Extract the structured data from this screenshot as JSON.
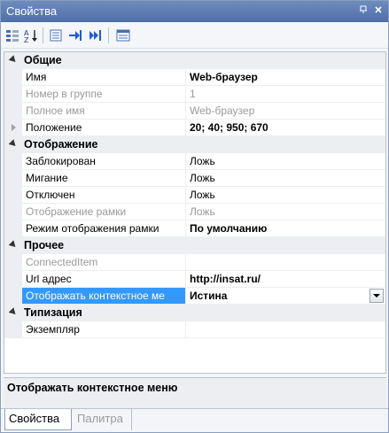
{
  "window": {
    "title": "Свойства"
  },
  "toolbar": {
    "tools": [
      "categorized-icon",
      "alphabetical-icon",
      "properties-icon",
      "events-icon",
      "bindings-icon",
      "property-pages-icon"
    ]
  },
  "grid": {
    "categories": [
      {
        "label": "Общие",
        "props": [
          {
            "name": "Имя",
            "value": "Web-браузер"
          },
          {
            "name": "Номер в группе",
            "value": "1"
          },
          {
            "name": "Полное имя",
            "value": "Web-браузер"
          },
          {
            "name": "Положение",
            "value": "20; 40; 950; 670"
          }
        ]
      },
      {
        "label": "Отображение",
        "props": [
          {
            "name": "Заблокирован",
            "value": "Ложь"
          },
          {
            "name": "Мигание",
            "value": "Ложь"
          },
          {
            "name": "Отключен",
            "value": "Ложь"
          },
          {
            "name": "Отображение рамки",
            "value": "Ложь"
          },
          {
            "name": "Режим отображения рамки",
            "value": "По умолчанию"
          }
        ]
      },
      {
        "label": "Прочее",
        "props": [
          {
            "name": "ConnectedItem",
            "value": ""
          },
          {
            "name": "Url адрес",
            "value": "http://insat.ru/"
          },
          {
            "name": "Отображать контекстное ме",
            "value": "Истина"
          }
        ]
      },
      {
        "label": "Типизация",
        "props": [
          {
            "name": "Экземпляр",
            "value": ""
          }
        ]
      }
    ]
  },
  "description": {
    "text": "Отображать контекстное меню"
  },
  "tabs": [
    {
      "label": "Свойства",
      "active": true
    },
    {
      "label": "Палитра",
      "active": false
    }
  ],
  "colors": {
    "selection": "#3399ff",
    "titlebar": "#5b7bb3",
    "gray_text": "#9a9a9a"
  }
}
